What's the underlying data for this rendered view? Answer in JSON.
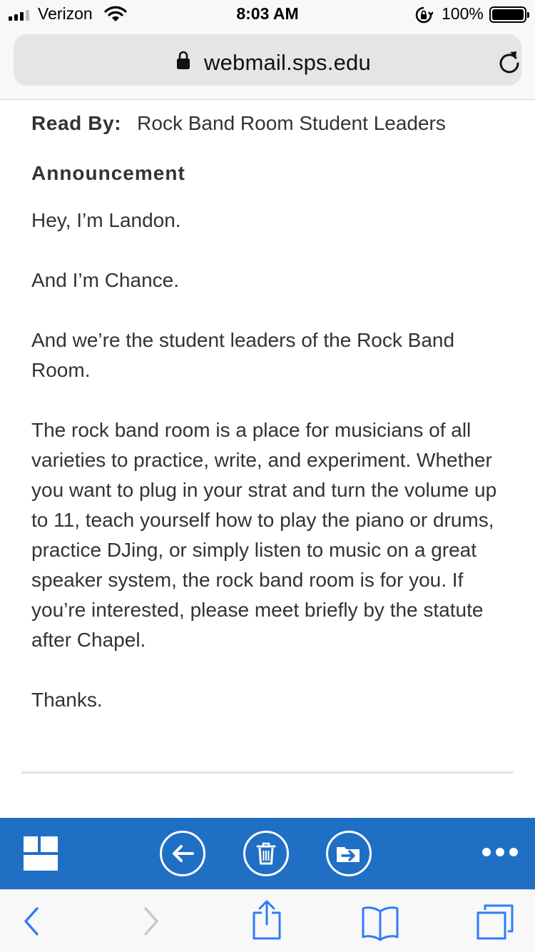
{
  "status_bar": {
    "carrier": "Verizon",
    "time": "8:03 AM",
    "battery": "100%"
  },
  "address_bar": {
    "url": "webmail.sps.edu"
  },
  "message": {
    "read_by_label": "Read By:",
    "read_by_value": "Rock Band Room Student Leaders",
    "section_heading": "Announcement",
    "paragraphs": [
      "Hey, I’m Landon.",
      "And I’m Chance.",
      "And we’re the student leaders of the Rock Band Room.",
      "The rock band room is a place for musicians of all varieties to practice, write, and experiment. Whether you want to plug in your strat and turn the volume up to 11, teach yourself how to play the piano or drums, practice DJing, or simply listen to music on a great speaker system, the rock band room is for you. If you’re interested, please meet briefly by the statute after Chapel.",
      "Thanks."
    ]
  },
  "owa_toolbar": {
    "color": "#1f6fc5",
    "icons": [
      "app-grid-icon",
      "back-arrow-icon",
      "trash-icon",
      "move-to-folder-icon",
      "more-icon"
    ]
  },
  "safari_toolbar": {
    "tint": "#2f7cf6",
    "icons": [
      "chevron-left-icon",
      "chevron-right-icon",
      "share-icon",
      "bookmarks-icon",
      "tabs-icon"
    ]
  }
}
